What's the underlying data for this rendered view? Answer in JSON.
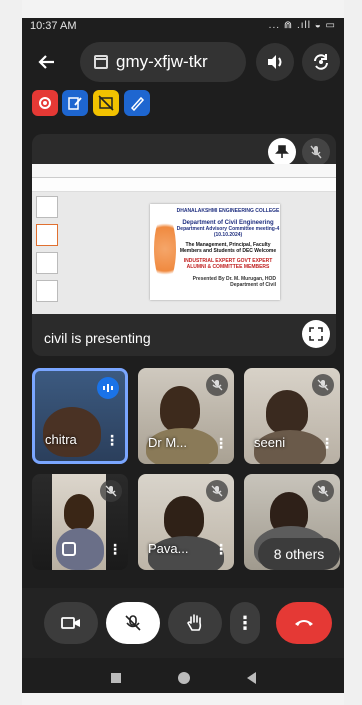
{
  "status_bar": {
    "time": "10:37 AM",
    "icons": "... ⋒ .ıll ◒ ▭"
  },
  "header": {
    "meeting_code": "gmy-xfjw-tkr"
  },
  "tools": [
    {
      "icon": "record-icon",
      "color": "#e53935"
    },
    {
      "icon": "note-pen-icon",
      "color": "#1e66d0"
    },
    {
      "icon": "no-captions-icon",
      "color": "#f2c200"
    },
    {
      "icon": "whiteboard-pen-icon",
      "color": "#1e66d0"
    }
  ],
  "presentation": {
    "label": "civil is presenting",
    "slide": {
      "college": "DHANALAKSHMI ENGINEERING COLLEGE",
      "department": "Department of Civil Engineering",
      "meeting": "Department Advisory Committee meeting-4",
      "date": "(10.10.2024)",
      "audience": "The Management, Principal, Faculty Members and Students of DEC Welcome",
      "guests": "INDUSTRIAL EXPERT GOVT EXPERT ALUMNI & COMMITTEE MEMBERS",
      "presenter": "Presented By Dr. M. Murugan, HOD Department of Civil"
    }
  },
  "participants": [
    {
      "name": "chitra",
      "speaking": true,
      "muted": false
    },
    {
      "name": "Dr M...",
      "speaking": false,
      "muted": true
    },
    {
      "name": "seeni",
      "speaking": false,
      "muted": true
    },
    {
      "name": "",
      "speaking": false,
      "muted": true
    },
    {
      "name": "Pava...",
      "speaking": false,
      "muted": true
    },
    {
      "name": "",
      "speaking": false,
      "muted": true
    }
  ],
  "others_label": "8 others",
  "controls": {
    "camera": "camera-icon",
    "mic": "mic-off-icon",
    "hand": "raise-hand-icon",
    "more": "more-options-icon",
    "end": "end-call-icon",
    "end_color": "#e53935"
  },
  "nav": [
    "recents-icon",
    "home-icon",
    "back-icon"
  ]
}
